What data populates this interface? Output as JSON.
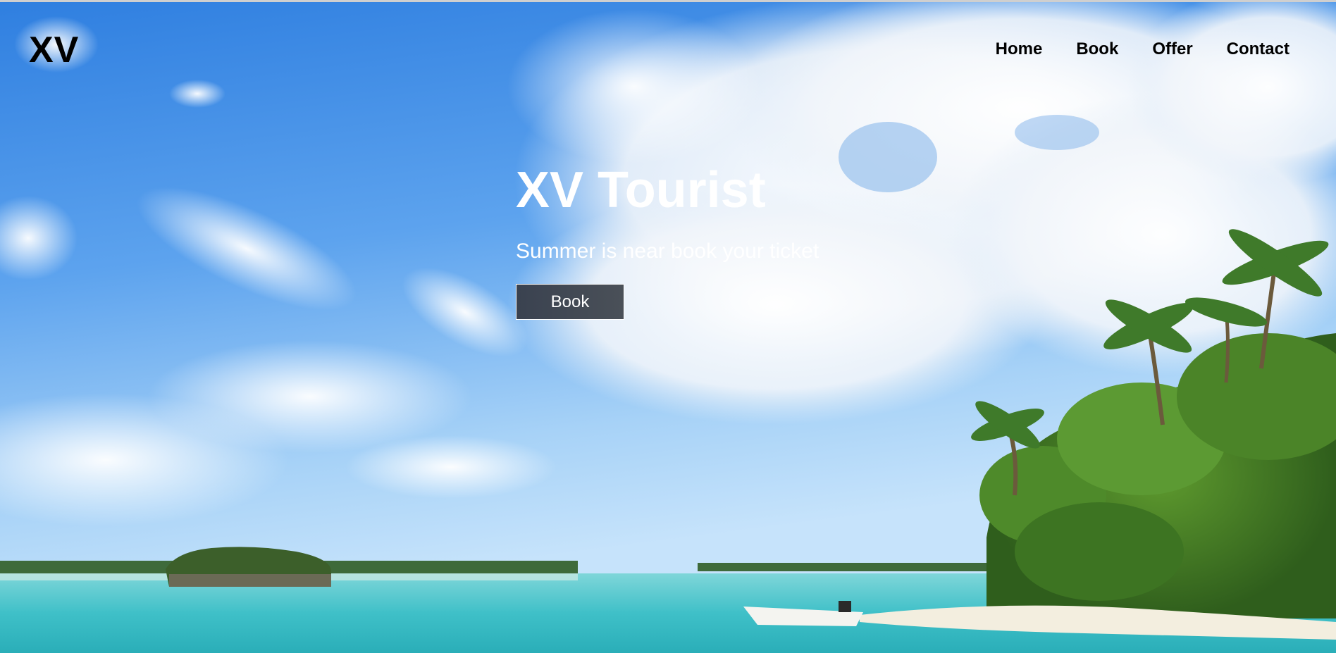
{
  "header": {
    "logo": "XV",
    "nav": [
      {
        "label": "Home"
      },
      {
        "label": "Book"
      },
      {
        "label": "Offer"
      },
      {
        "label": "Contact"
      }
    ]
  },
  "hero": {
    "title": "XV Tourist",
    "subtitle": "Summer is near book your ticket",
    "button_label": "Book",
    "image": "tropical-beach-photo",
    "button_color": "#3f4752",
    "text_color": "#ffffff"
  }
}
